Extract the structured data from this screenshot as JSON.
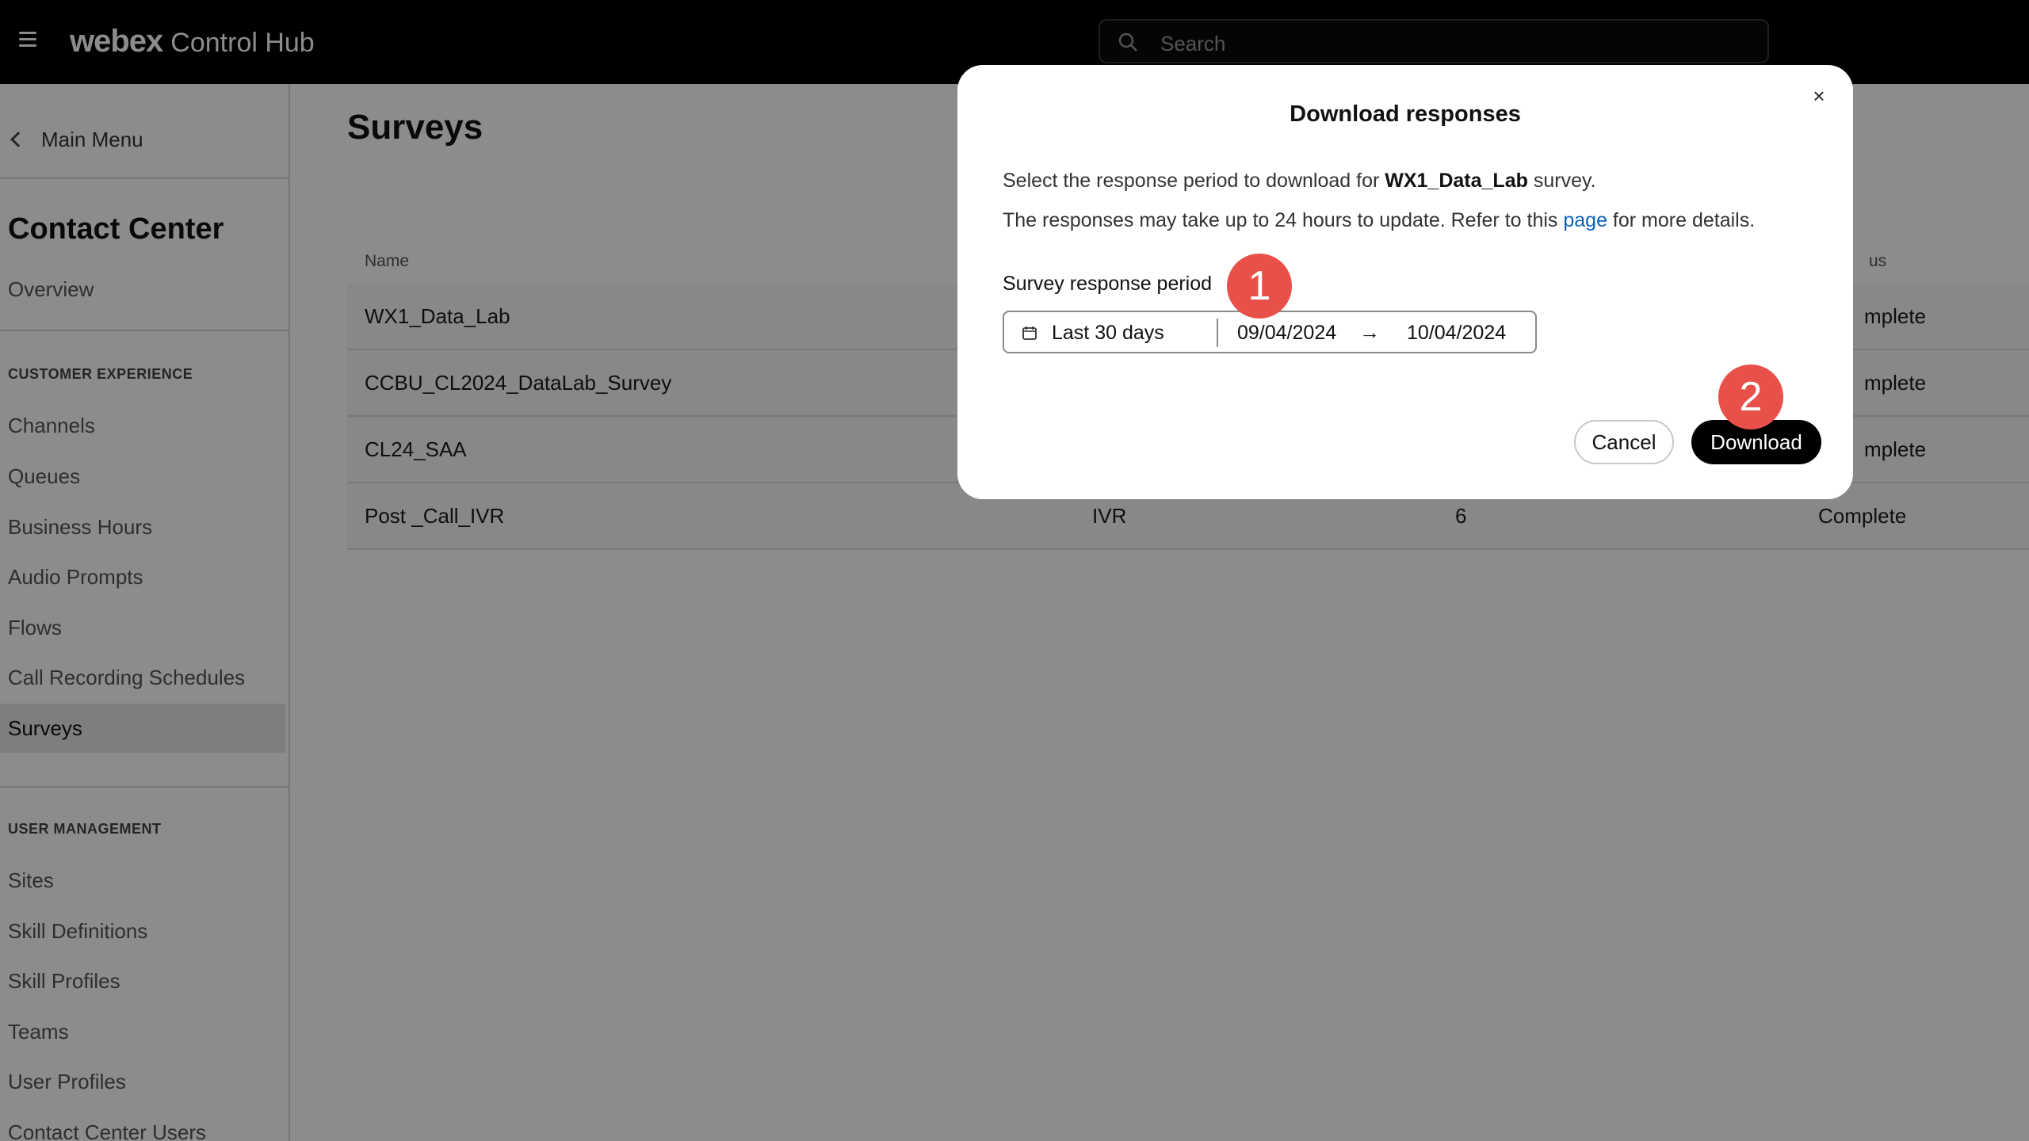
{
  "header": {
    "brand": "webex",
    "product": "Control Hub",
    "search_placeholder": "Search"
  },
  "sidebar": {
    "main_menu": "Main Menu",
    "section_title": "Contact Center",
    "overview": "Overview",
    "groups": [
      {
        "label": "CUSTOMER EXPERIENCE",
        "items": [
          "Channels",
          "Queues",
          "Business Hours",
          "Audio Prompts",
          "Flows",
          "Call Recording Schedules",
          "Surveys"
        ]
      },
      {
        "label": "USER MANAGEMENT",
        "items": [
          "Sites",
          "Skill Definitions",
          "Skill Profiles",
          "Teams",
          "User Profiles",
          "Contact Center Users"
        ]
      }
    ],
    "active_item": "Surveys"
  },
  "main": {
    "title": "Surveys",
    "table": {
      "columns": [
        "Name",
        "",
        "",
        "us"
      ],
      "rows": [
        [
          "WX1_Data_Lab",
          "",
          "",
          "mplete"
        ],
        [
          "CCBU_CL2024_DataLab_Survey",
          "",
          "",
          "mplete"
        ],
        [
          "CL24_SAA",
          "",
          "",
          "mplete"
        ],
        [
          "Post _Call_IVR",
          "IVR",
          "6",
          "Complete"
        ]
      ]
    }
  },
  "modal": {
    "title": "Download responses",
    "close_label": "×",
    "line1_prefix": "Select the response period to download for ",
    "survey_name": "WX1_Data_Lab",
    "line1_suffix": " survey.",
    "line2_prefix": "The responses may take up to 24 hours to update. Refer to this ",
    "line2_link": "page",
    "line2_suffix": " for more details.",
    "period_label": "Survey response period",
    "preset": "Last 30 days",
    "start_date": "09/04/2024",
    "arrow": "→",
    "end_date": "10/04/2024",
    "cancel_label": "Cancel",
    "download_label": "Download"
  },
  "annotations": {
    "step1": "1",
    "step2": "2",
    "color": "#e8514a"
  }
}
